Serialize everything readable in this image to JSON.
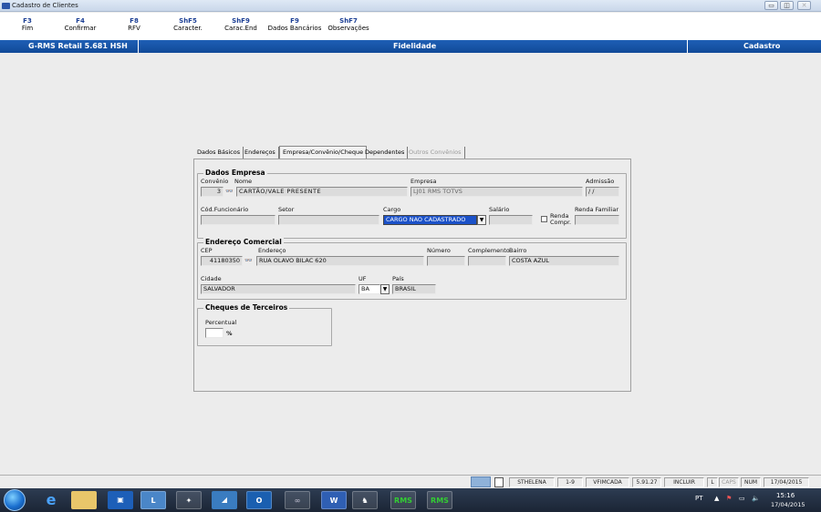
{
  "window": {
    "title": "Cadastro de Clientes",
    "minimize": "▭",
    "maximize": "◫",
    "close": "✕"
  },
  "function_keys": [
    {
      "key": "F3",
      "label": "Fim"
    },
    {
      "key": "F4",
      "label": "Confirmar"
    },
    {
      "key": "F8",
      "label": "RFV"
    },
    {
      "key": "ShF5",
      "label": "Caracter."
    },
    {
      "key": "ShF9",
      "label": "Carac.End"
    },
    {
      "key": "F9",
      "label": "Dados Bancários"
    },
    {
      "key": "ShF7",
      "label": "Observações"
    }
  ],
  "header": {
    "version": "G-RMS Retail 5.681 HSH",
    "module": "Fidelidade",
    "section": "Cadastro"
  },
  "tabs": [
    {
      "label": "Dados Básicos",
      "active": false,
      "disabled": false
    },
    {
      "label": "Endereços",
      "active": false,
      "disabled": false
    },
    {
      "label": "Empresa/Convênio/Cheque",
      "active": true,
      "disabled": false
    },
    {
      "label": "Dependentes",
      "active": false,
      "disabled": false
    },
    {
      "label": "Outros Convênios",
      "active": false,
      "disabled": true
    }
  ],
  "dados_empresa": {
    "title": "Dados Empresa",
    "convenio_label": "Convênio",
    "nome_label": "Nome",
    "empresa_label": "Empresa",
    "admissao_label": "Admissão",
    "convenio_value": "3",
    "nome_value": "CARTÃO/VALE PRESENTE",
    "empresa_value": "LJ01 RMS TOTVS",
    "admissao_value": "/ /",
    "cod_funcionario_label": "Cód.Funcionário",
    "setor_label": "Setor",
    "cargo_label": "Cargo",
    "salario_label": "Salário",
    "renda_familiar_label": "Renda Familiar",
    "cargo_value": "CARGO NAO CADASTRADO",
    "renda_compr_label_1": "Renda",
    "renda_compr_label_2": "Compr."
  },
  "endereco_comercial": {
    "title": "Endereço Comercial",
    "cep_label": "CEP",
    "endereco_label": "Endereço",
    "numero_label": "Número",
    "complemento_label": "Complemento",
    "bairro_label": "Bairro",
    "cep_value": "41180350",
    "endereco_value": "RUA OLAVO BILAC 620",
    "bairro_value": "COSTA AZUL",
    "cidade_label": "Cidade",
    "uf_label": "UF",
    "pais_label": "País",
    "cidade_value": "SALVADOR",
    "uf_value": "BA",
    "pais_value": "BRASIL"
  },
  "cheques": {
    "title": "Cheques de Terceiros",
    "percentual_label": "Percentual",
    "percent_sign": "%"
  },
  "statusbar": {
    "user": "STHELENA",
    "code": "1-9",
    "program": "VFIMCADA",
    "version": "5.91.27",
    "mode": "INCLUIR",
    "l": "L",
    "caps": "CAPS",
    "num": "NUM",
    "date": "17/04/2015"
  },
  "taskbar": {
    "lang": "PT",
    "time": "15:16",
    "date": "17/04/2015"
  }
}
